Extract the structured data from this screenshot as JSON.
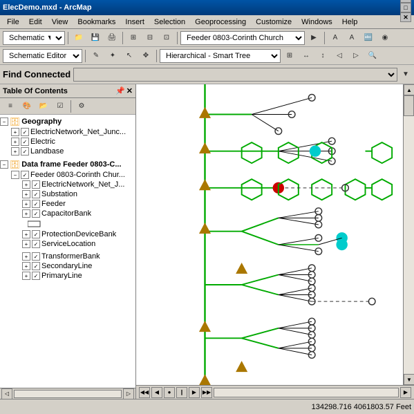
{
  "titleBar": {
    "title": "ElecDemo.mxd - ArcMap",
    "minBtn": "─",
    "maxBtn": "□",
    "closeBtn": "✕"
  },
  "menuBar": {
    "items": [
      "File",
      "Edit",
      "View",
      "Bookmarks",
      "Insert",
      "Selection",
      "Geoprocessing",
      "Customize",
      "Windows",
      "Help"
    ]
  },
  "toolbar1": {
    "schematicDropdown": "Schematic ▼",
    "editorDropdown": "Schematic Editor ▼",
    "feederDropdown": "Feeder 0803-Corinth Church",
    "smartTreeDropdown": "Hierarchical - Smart Tree"
  },
  "findConnected": {
    "label": "Find Connected",
    "dropdownValue": ""
  },
  "tocHeader": {
    "label": "Table Of Contents"
  },
  "toc": {
    "groups": [
      {
        "id": "geography",
        "label": "Geography",
        "expanded": true,
        "type": "dataframe",
        "children": [
          {
            "id": "electricnetwork_junc",
            "label": "ElectricNetwork_Net_Junc...",
            "checked": true,
            "type": "layer"
          },
          {
            "id": "electric",
            "label": "Electric",
            "checked": true,
            "type": "layer"
          },
          {
            "id": "landbase",
            "label": "Landbase",
            "checked": true,
            "type": "layer"
          }
        ]
      },
      {
        "id": "dataframe_feeder",
        "label": "Data frame Feeder 0803-C...",
        "expanded": true,
        "type": "dataframe",
        "children": [
          {
            "id": "feeder_corinth",
            "label": "Feeder 0803-Corinth Chur...",
            "checked": true,
            "type": "schematic",
            "expanded": true,
            "children": [
              {
                "id": "electricnetwork_j2",
                "label": "ElectricNetwork_Net_J...",
                "checked": true,
                "type": "layer"
              },
              {
                "id": "substation",
                "label": "Substation",
                "checked": true,
                "type": "layer"
              },
              {
                "id": "feeder",
                "label": "Feeder",
                "checked": true,
                "type": "layer"
              },
              {
                "id": "capacitorbank",
                "label": "CapacitorBank",
                "checked": true,
                "type": "layer"
              },
              {
                "id": "protectiondevicebank",
                "label": "ProtectionDeviceBank",
                "checked": true,
                "type": "layer"
              },
              {
                "id": "servicelocation",
                "label": "ServiceLocation",
                "checked": true,
                "type": "layer"
              },
              {
                "id": "transformerbank",
                "label": "TransformerBank",
                "checked": true,
                "type": "layer"
              },
              {
                "id": "secondaryline",
                "label": "SecondaryLine",
                "checked": true,
                "type": "layer"
              },
              {
                "id": "primaryline",
                "label": "PrimaryLine",
                "checked": true,
                "type": "layer"
              }
            ]
          }
        ]
      }
    ]
  },
  "statusBar": {
    "coordinates": "134298.716  4061803.57 Feet"
  },
  "mapBottomBar": {
    "buttons": [
      "◄",
      "◄|",
      "●",
      "||",
      "►|",
      "►"
    ]
  }
}
